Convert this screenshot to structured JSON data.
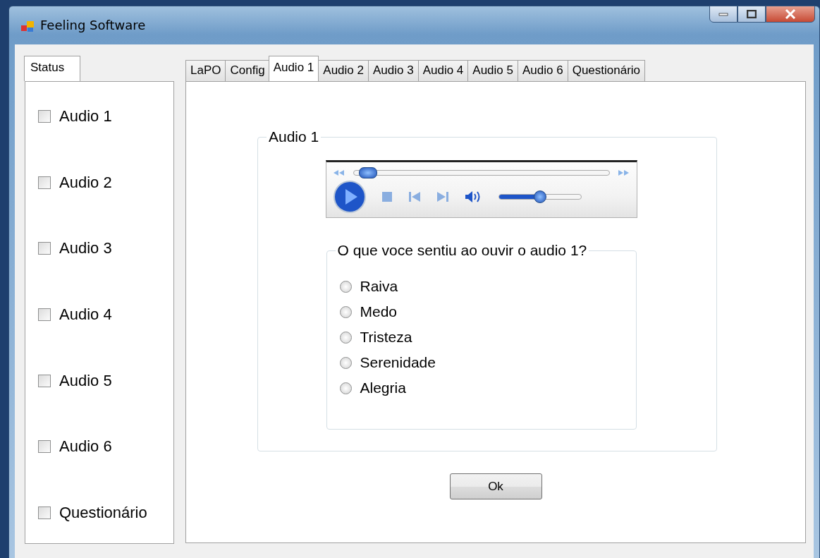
{
  "window": {
    "title": "Feeling Software"
  },
  "status_panel": {
    "tab": "Status",
    "items": [
      {
        "label": "Audio 1",
        "checked": false
      },
      {
        "label": "Audio 2",
        "checked": false
      },
      {
        "label": "Audio 3",
        "checked": false
      },
      {
        "label": "Audio 4",
        "checked": false
      },
      {
        "label": "Audio 5",
        "checked": false
      },
      {
        "label": "Audio 6",
        "checked": false
      },
      {
        "label": "Questionário",
        "checked": false
      }
    ]
  },
  "tabs": [
    {
      "label": "LaPO",
      "selected": false
    },
    {
      "label": "Config",
      "selected": false
    },
    {
      "label": "Audio 1",
      "selected": true
    },
    {
      "label": "Audio 2",
      "selected": false
    },
    {
      "label": "Audio 3",
      "selected": false
    },
    {
      "label": "Audio 4",
      "selected": false
    },
    {
      "label": "Audio 5",
      "selected": false
    },
    {
      "label": "Audio 6",
      "selected": false
    },
    {
      "label": "Questionário",
      "selected": false
    }
  ],
  "group": {
    "title": "Audio 1",
    "player": {
      "seek": {
        "level": 0.03
      },
      "volume": {
        "level": 0.5
      }
    },
    "question": {
      "title": "O que voce sentiu ao ouvir o audio 1?",
      "options": [
        {
          "label": "Raiva",
          "selected": false
        },
        {
          "label": "Medo",
          "selected": false
        },
        {
          "label": "Tristeza",
          "selected": false
        },
        {
          "label": "Serenidade",
          "selected": false
        },
        {
          "label": "Alegria",
          "selected": false
        }
      ]
    }
  },
  "ok_button": "Ok"
}
